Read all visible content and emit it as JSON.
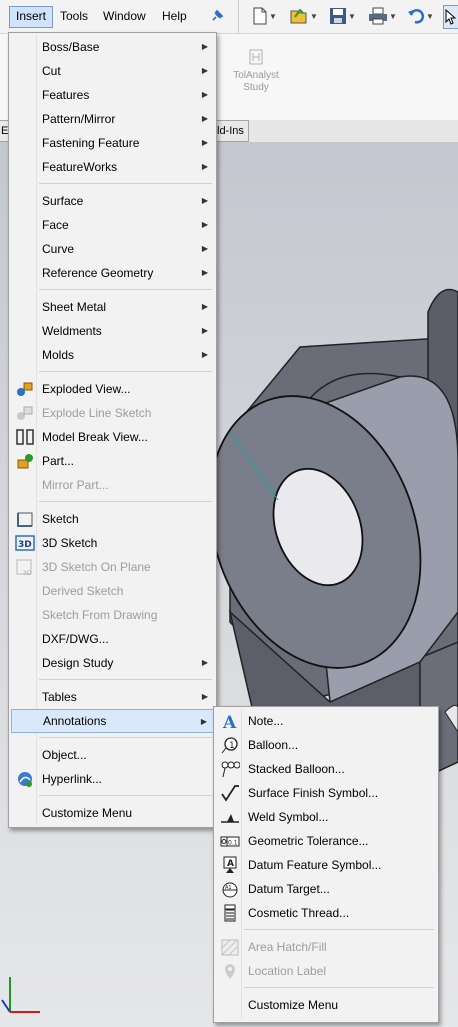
{
  "menubar": {
    "items": [
      "Insert",
      "Tools",
      "Window",
      "Help"
    ]
  },
  "toolbar": {
    "tolanalyst_line1": "TolAnalyst",
    "tolanalyst_line2": "Study"
  },
  "tabs": [
    "Ev",
    "ld-Ins"
  ],
  "insert_menu": {
    "items": [
      {
        "label": "Boss/Base",
        "submenu": true,
        "enabled": true
      },
      {
        "label": "Cut",
        "submenu": true,
        "enabled": true
      },
      {
        "label": "Features",
        "submenu": true,
        "enabled": true
      },
      {
        "label": "Pattern/Mirror",
        "submenu": true,
        "enabled": true
      },
      {
        "label": "Fastening Feature",
        "submenu": true,
        "enabled": true
      },
      {
        "label": "FeatureWorks",
        "submenu": true,
        "enabled": true
      },
      {
        "label": "Surface",
        "submenu": true,
        "enabled": true
      },
      {
        "label": "Face",
        "submenu": true,
        "enabled": true
      },
      {
        "label": "Curve",
        "submenu": true,
        "enabled": true
      },
      {
        "label": "Reference Geometry",
        "submenu": true,
        "enabled": true
      },
      {
        "label": "Sheet Metal",
        "submenu": true,
        "enabled": true
      },
      {
        "label": "Weldments",
        "submenu": true,
        "enabled": true
      },
      {
        "label": "Molds",
        "submenu": true,
        "enabled": true
      },
      {
        "label": "Exploded View...",
        "icon": "exploded-view-icon",
        "enabled": true
      },
      {
        "label": "Explode Line Sketch",
        "icon": "explode-line-sketch-icon",
        "enabled": false
      },
      {
        "label": "Model Break View...",
        "icon": "model-break-view-icon",
        "enabled": true
      },
      {
        "label": "Part...",
        "icon": "part-icon",
        "enabled": true
      },
      {
        "label": "Mirror Part...",
        "enabled": false
      },
      {
        "label": "Sketch",
        "icon": "sketch-icon",
        "enabled": true
      },
      {
        "label": "3D Sketch",
        "icon": "3d-sketch-icon",
        "enabled": true
      },
      {
        "label": "3D Sketch On Plane",
        "icon": "3d-sketch-on-plane-icon",
        "enabled": false
      },
      {
        "label": "Derived Sketch",
        "enabled": false
      },
      {
        "label": "Sketch From Drawing",
        "enabled": false
      },
      {
        "label": "DXF/DWG...",
        "enabled": true
      },
      {
        "label": "Design Study",
        "submenu": true,
        "enabled": true
      },
      {
        "label": "Tables",
        "submenu": true,
        "enabled": true
      },
      {
        "label": "Annotations",
        "submenu": true,
        "enabled": true,
        "highlighted": true
      },
      {
        "label": "Object...",
        "enabled": true
      },
      {
        "label": "Hyperlink...",
        "icon": "hyperlink-icon",
        "enabled": true
      },
      {
        "label": "Customize Menu",
        "enabled": true
      }
    ]
  },
  "annotations_menu": {
    "items": [
      {
        "label": "Note...",
        "icon": "note-icon",
        "enabled": true
      },
      {
        "label": "Balloon...",
        "icon": "balloon-icon",
        "enabled": true
      },
      {
        "label": "Stacked Balloon...",
        "icon": "stacked-balloon-icon",
        "enabled": true
      },
      {
        "label": "Surface Finish Symbol...",
        "icon": "surface-finish-icon",
        "enabled": true
      },
      {
        "label": "Weld Symbol...",
        "icon": "weld-symbol-icon",
        "enabled": true
      },
      {
        "label": "Geometric Tolerance...",
        "icon": "geometric-tolerance-icon",
        "enabled": true
      },
      {
        "label": "Datum Feature Symbol...",
        "icon": "datum-feature-icon",
        "enabled": true
      },
      {
        "label": "Datum Target...",
        "icon": "datum-target-icon",
        "enabled": true
      },
      {
        "label": "Cosmetic Thread...",
        "icon": "cosmetic-thread-icon",
        "enabled": true
      },
      {
        "label": "Area Hatch/Fill",
        "icon": "area-hatch-icon",
        "enabled": false
      },
      {
        "label": "Location Label",
        "icon": "location-label-icon",
        "enabled": false
      },
      {
        "label": "Customize Menu",
        "enabled": true
      }
    ]
  },
  "colors": {
    "highlight": "#d9e8fb",
    "accent": "#2a6fc9",
    "disabled_text": "#9d9d9d"
  }
}
